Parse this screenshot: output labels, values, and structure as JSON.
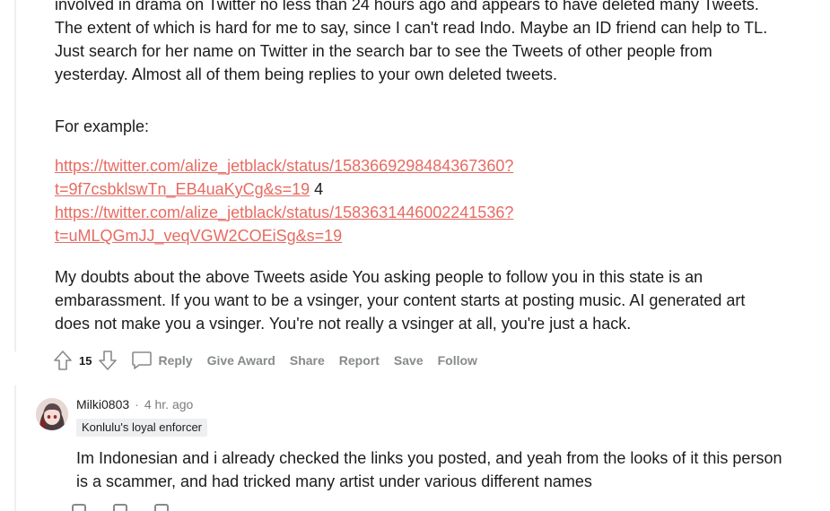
{
  "post": {
    "paragraph_top": "involved in drama on Twitter no less than 24 hours ago and appears to have deleted many Tweets. The extent of which is hard for me to say, since I can't read Indo. Maybe an ID friend can help to TL. Just search for her name on Twitter in the search bar to see the Tweets of other people from yesterday. Almost all of them being replies to your own deleted tweets.",
    "example_label": "For example:",
    "link1_a": "https://twitter.com/alize_jetblack/status/1583669298484367360?",
    "link1_b": "t=9f7csbklswTn_EB4uaKyCg&s=19",
    "link1_suffix": " 4",
    "link2_a": "https://twitter.com/alize_jetblack/status/1583631446002241536?",
    "link2_b": "t=uMLQGmJJ_veqVGW2COEiSg&s=19",
    "paragraph_doubts": "My doubts about the above Tweets aside You asking people to follow you in this state is an embarassment. If you want to be a vsinger, your content starts at posting music. AI generated art does not make you a vsinger. You're not really a vsinger at all, you're just a hack."
  },
  "actions": {
    "score": "15",
    "reply": "Reply",
    "give_award": "Give Award",
    "share": "Share",
    "report": "Report",
    "save": "Save",
    "follow": "Follow"
  },
  "reply": {
    "username": "Milki0803",
    "separator": "·",
    "time": "4 hr. ago",
    "flair": "Konlulu's loyal enforcer",
    "text": "Im Indonesian and i already checked the links you posted, and yeah from the looks of it this person is a scammer, and had tricked many artist under various different names"
  },
  "colors": {
    "link": "#e76b61",
    "meta_gray": "#878a8c",
    "flair_bg": "#edeff1"
  },
  "icons": {
    "upvote": "arrow-up-icon",
    "downvote": "arrow-down-icon",
    "reply": "speech-bubble-icon"
  }
}
